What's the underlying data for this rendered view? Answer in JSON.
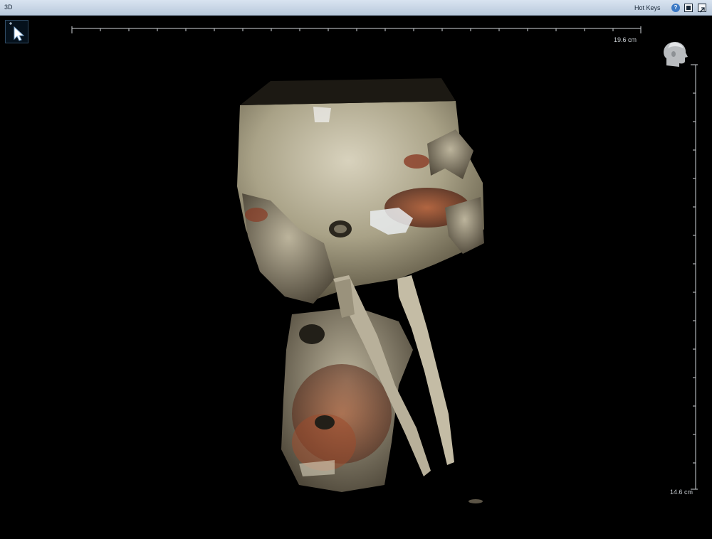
{
  "window": {
    "title": "3D"
  },
  "toolbar": {
    "hotkeys_label": "Hot Keys"
  },
  "icons": [
    "help-icon",
    "layout-icon",
    "export-icon",
    "pointer-tool-icon",
    "orientation-head-icon"
  ],
  "rulers": {
    "horizontal_label": "19.6 cm",
    "vertical_label": "14.6 cm"
  }
}
